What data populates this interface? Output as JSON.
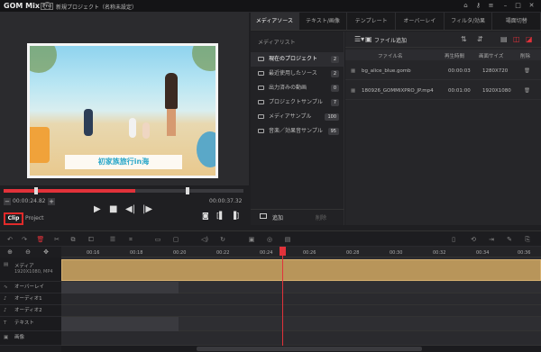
{
  "app": {
    "logo": "GOM Mix",
    "edition": "Pro",
    "title": "新規プロジェクト（名称未設定）"
  },
  "preview": {
    "caption": "初家族旅行in海",
    "current_time": "00:00:24.82",
    "total_time": "00:00:37.32",
    "seek_progress": 0.55,
    "tabs": {
      "clip": "Clip",
      "project": "Project"
    }
  },
  "media": {
    "tabs": [
      "メディアソース",
      "テキスト/画像",
      "テンプレート",
      "オーバーレイ",
      "フィルタ/効果",
      "場面切替"
    ],
    "list_title": "メディアリスト",
    "list_items": [
      {
        "label": "現在のプロジェクト",
        "count": "2"
      },
      {
        "label": "最近使用したソース",
        "count": "2"
      },
      {
        "label": "出力済みの動画",
        "count": "0"
      },
      {
        "label": "プロジェクトサンプル",
        "count": "7"
      },
      {
        "label": "メディアサンプル",
        "count": "100"
      },
      {
        "label": "音楽／効果音サンプル",
        "count": "95"
      }
    ],
    "add_label": "追加",
    "delete_label": "削除",
    "add_file_label": "ファイル追加",
    "columns": {
      "name": "ファイル名",
      "duration": "再生時間",
      "size": "画面サイズ",
      "delete": "削除"
    },
    "files": [
      {
        "name": "bg_alice_blue.gomb",
        "duration": "00:00:03",
        "size": "1280X720"
      },
      {
        "name": "180926_GOMMIXPRO_JP.mp4",
        "duration": "00:01:00",
        "size": "1920X1080"
      }
    ]
  },
  "timeline": {
    "ruler": [
      "00:16",
      "00:18",
      "00:20",
      "00:22",
      "00:24",
      "00:26",
      "00:28",
      "00:30",
      "00:32",
      "00:34",
      "00:36"
    ],
    "tracks": [
      {
        "label": "メディア",
        "sub": "1920X1080, MP4"
      },
      {
        "label": "オーバーレイ"
      },
      {
        "label": "オーディオ1"
      },
      {
        "label": "オーディオ2"
      },
      {
        "label": "テキスト"
      },
      {
        "label": "画像"
      }
    ]
  },
  "colors": {
    "accent": "#e2323a",
    "clip": "#b8955a",
    "caption": "#2aa7c9"
  }
}
